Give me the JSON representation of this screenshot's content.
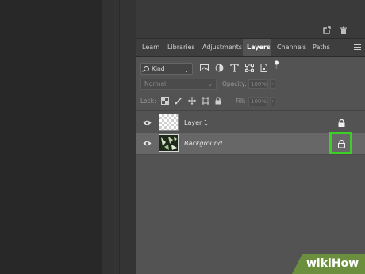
{
  "tabs": [
    {
      "label": "Learn",
      "active": false
    },
    {
      "label": "Libraries",
      "active": false
    },
    {
      "label": "Adjustments",
      "active": false
    },
    {
      "label": "Layers",
      "active": true
    },
    {
      "label": "Channels",
      "active": false
    },
    {
      "label": "Paths",
      "active": false
    }
  ],
  "filter": {
    "kind_label": "Kind",
    "icons": [
      "image-filter-icon",
      "adjustment-filter-icon",
      "type-filter-icon",
      "shape-filter-icon",
      "smart-object-filter-icon",
      "filter-toggle-icon"
    ]
  },
  "blend": {
    "mode": "Normal",
    "opacity_label": "Opacity:",
    "opacity_value": "100%",
    "lock_label": "Lock:",
    "fill_label": "Fill:",
    "fill_value": "100%"
  },
  "layers": [
    {
      "name": "Layer 1",
      "visible": true,
      "locked": true,
      "selected": false
    },
    {
      "name": "Background",
      "visible": true,
      "locked": true,
      "selected": true
    }
  ],
  "watermark": "wikiHow",
  "colors": {
    "panel": "#535353",
    "selected_row": "#676767",
    "highlight": "#3dce2a",
    "watermark_bg": "#6b8f3e"
  }
}
